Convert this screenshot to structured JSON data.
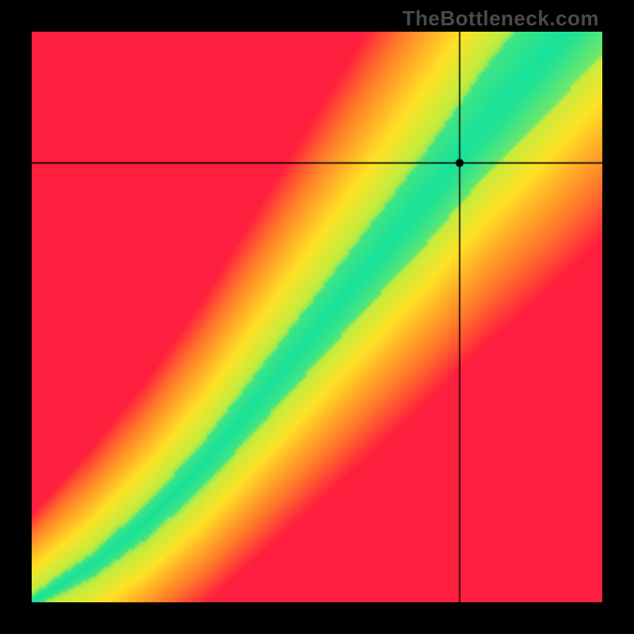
{
  "watermark": {
    "text": "TheBottleneck.com"
  },
  "chart_data": {
    "type": "heatmap",
    "title": "",
    "xlabel": "",
    "ylabel": "",
    "xlim": [
      0,
      100
    ],
    "ylim": [
      0,
      100
    ],
    "x_axis_meaning": "CPU performance (relative)",
    "y_axis_meaning": "GPU performance (relative)",
    "value_meaning": "bottleneck balance: 0 = perfect match (green), 1 = severe bottleneck (red)",
    "color_stops": [
      {
        "t": 0.0,
        "color": "#18e29a"
      },
      {
        "t": 0.2,
        "color": "#c4ed3e"
      },
      {
        "t": 0.4,
        "color": "#ffe326"
      },
      {
        "t": 0.55,
        "color": "#ffb626"
      },
      {
        "t": 0.75,
        "color": "#ff7a2a"
      },
      {
        "t": 1.0,
        "color": "#ff1f3e"
      }
    ],
    "ideal_curve_points": [
      {
        "x": 0,
        "y": 0
      },
      {
        "x": 10,
        "y": 6
      },
      {
        "x": 20,
        "y": 14
      },
      {
        "x": 30,
        "y": 24
      },
      {
        "x": 40,
        "y": 36
      },
      {
        "x": 50,
        "y": 48
      },
      {
        "x": 60,
        "y": 60
      },
      {
        "x": 70,
        "y": 72
      },
      {
        "x": 80,
        "y": 85
      },
      {
        "x": 90,
        "y": 96
      },
      {
        "x": 100,
        "y": 108
      }
    ],
    "band_halfwidth_points": [
      {
        "x": 0,
        "w": 1.2
      },
      {
        "x": 20,
        "w": 3.0
      },
      {
        "x": 40,
        "w": 5.0
      },
      {
        "x": 60,
        "w": 7.0
      },
      {
        "x": 80,
        "w": 9.5
      },
      {
        "x": 100,
        "w": 12.0
      }
    ],
    "crosshair": {
      "x": 75,
      "y": 77
    },
    "marker": {
      "x": 75,
      "y": 77,
      "r": 5
    },
    "resolution": 160
  }
}
